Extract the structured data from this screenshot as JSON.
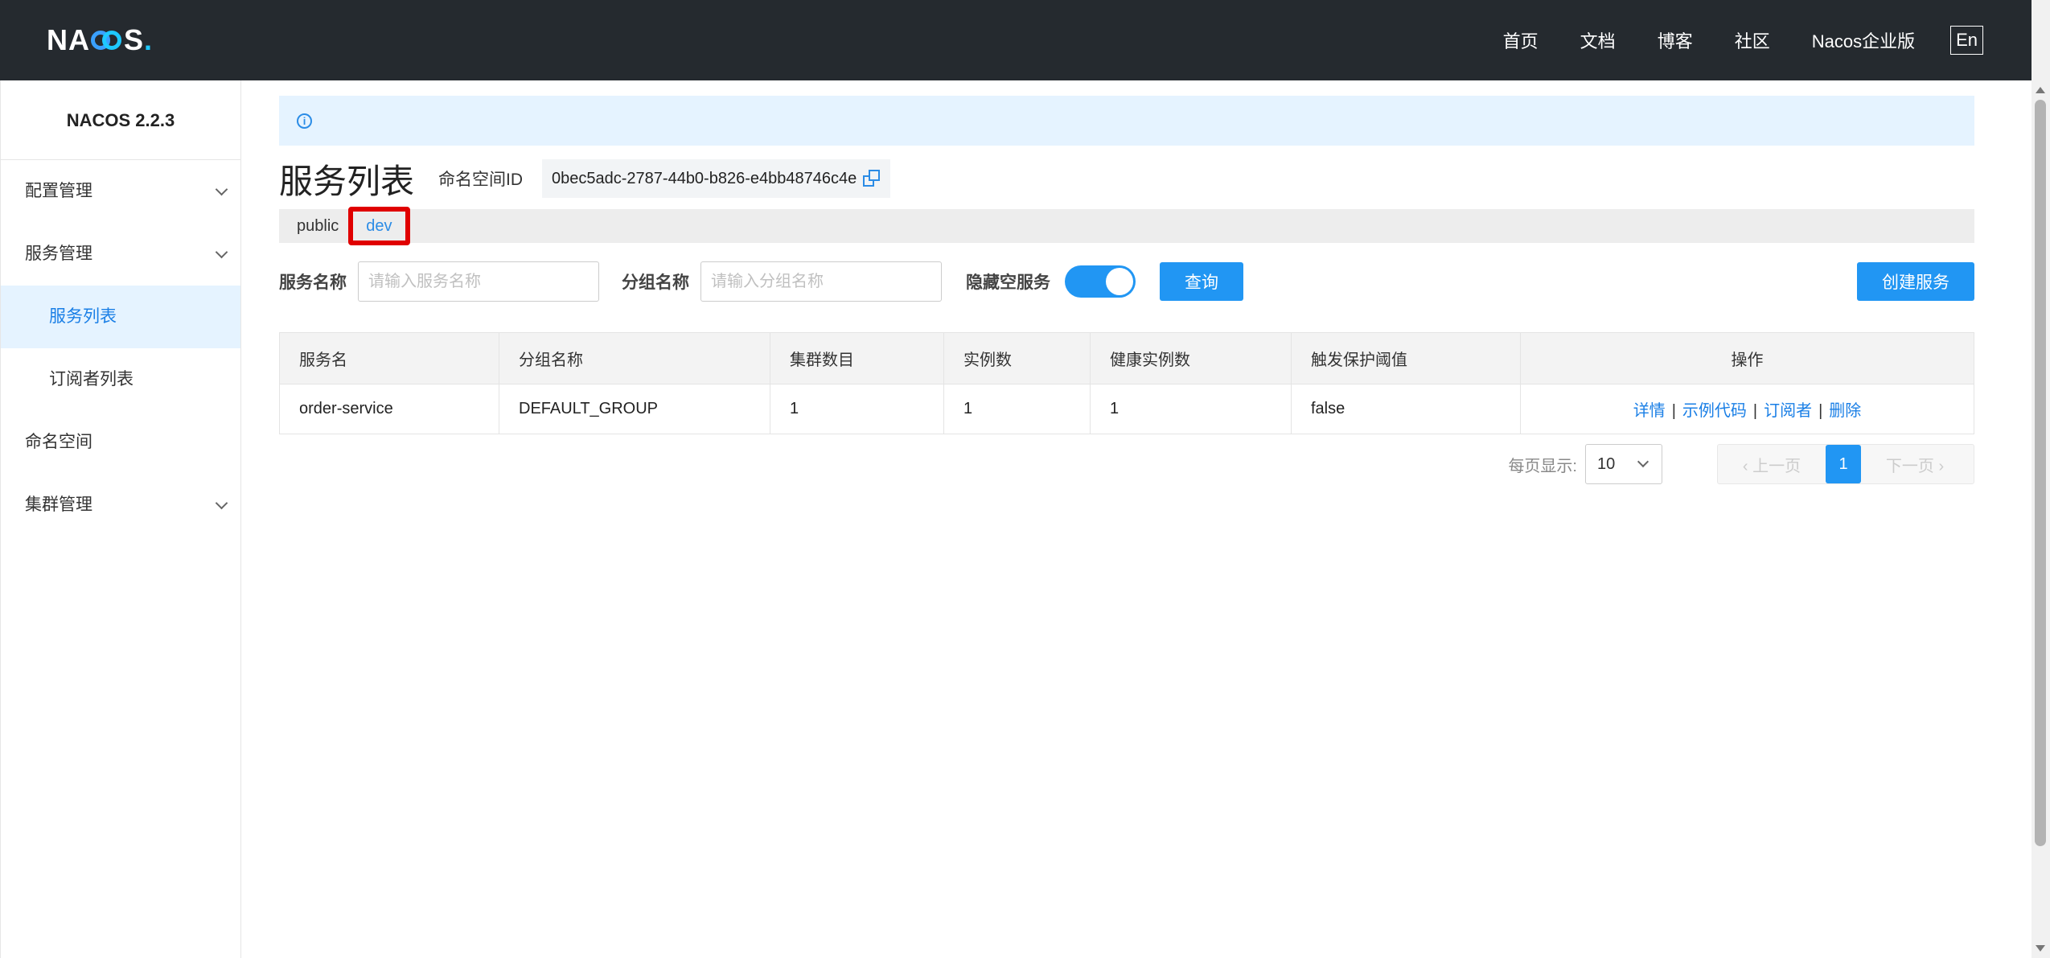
{
  "header": {
    "logo": "NACOS.",
    "logo_parts": [
      "NA",
      "S"
    ],
    "nav": [
      "首页",
      "文档",
      "博客",
      "社区",
      "Nacos企业版"
    ],
    "lang": "En"
  },
  "sidebar": {
    "title": "NACOS 2.2.3",
    "items": [
      {
        "label": "配置管理"
      },
      {
        "label": "服务管理"
      },
      {
        "label": "服务列表"
      },
      {
        "label": "订阅者列表"
      },
      {
        "label": "命名空间"
      },
      {
        "label": "集群管理"
      }
    ]
  },
  "page": {
    "title": "服务列表",
    "namespace_label": "命名空间ID",
    "namespace_id": "0bec5adc-2787-44b0-b826-e4bb48746c4e",
    "namespaces": [
      "public",
      "dev"
    ]
  },
  "filters": {
    "service_label": "服务名称",
    "service_placeholder": "请输入服务名称",
    "group_label": "分组名称",
    "group_placeholder": "请输入分组名称",
    "hide_empty_label": "隐藏空服务",
    "hide_empty": true,
    "query_button": "查询",
    "create_button": "创建服务"
  },
  "table": {
    "columns": [
      "服务名",
      "分组名称",
      "集群数目",
      "实例数",
      "健康实例数",
      "触发保护阈值",
      "操作"
    ],
    "rows": [
      {
        "service": "order-service",
        "group": "DEFAULT_GROUP",
        "clusters": "1",
        "instances": "1",
        "healthy": "1",
        "threshold": "false",
        "ops": [
          "详情",
          "示例代码",
          "订阅者",
          "删除"
        ]
      }
    ],
    "op_separator": "|"
  },
  "pagination": {
    "per_page_label": "每页显示:",
    "per_page": "10",
    "prev": "上一页",
    "current": "1",
    "next": "下一页"
  },
  "colors": {
    "accent": "#2196f3",
    "topbar": "#252a2f",
    "highlight_box": "#e00000"
  }
}
